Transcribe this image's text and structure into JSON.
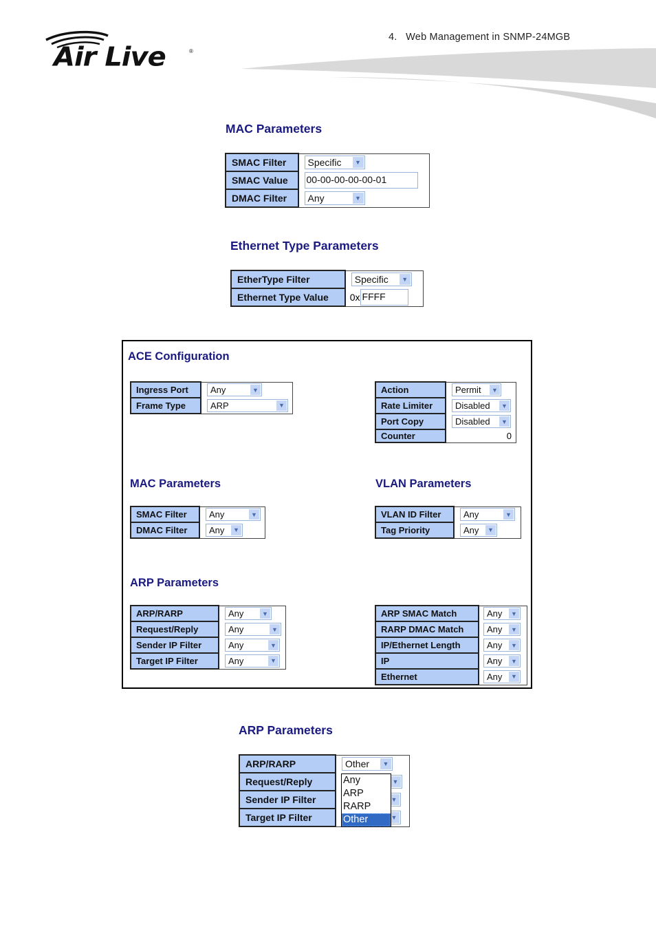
{
  "header": {
    "chapter": "4.   Web Management in SNMP-24MGB",
    "logo": {
      "text": "Air Live",
      "registered": "®"
    }
  },
  "mac_params_top": {
    "title": "MAC Parameters",
    "rows": [
      {
        "label": "SMAC Filter",
        "type": "select",
        "value": "Specific"
      },
      {
        "label": "SMAC Value",
        "type": "input",
        "value": "00-00-00-00-00-01"
      },
      {
        "label": "DMAC Filter",
        "type": "select",
        "value": "Any"
      }
    ]
  },
  "ethertype_params": {
    "title": "Ethernet Type Parameters",
    "rows": [
      {
        "label": "EtherType Filter",
        "type": "select",
        "value": "Specific"
      },
      {
        "label": "Ethernet Type Value",
        "type": "input",
        "prefix": "0x",
        "value": "FFFF"
      }
    ]
  },
  "ace": {
    "title": "ACE Configuration",
    "general": [
      {
        "label": "Ingress Port",
        "value": "Any"
      },
      {
        "label": "Frame Type",
        "value": "ARP"
      }
    ],
    "action": [
      {
        "label": "Action",
        "value": "Permit"
      },
      {
        "label": "Rate Limiter",
        "value": "Disabled"
      },
      {
        "label": "Port Copy",
        "value": "Disabled"
      },
      {
        "label": "Counter",
        "value": "0"
      }
    ],
    "mac": {
      "title": "MAC Parameters",
      "rows": [
        {
          "label": "SMAC Filter",
          "value": "Any"
        },
        {
          "label": "DMAC Filter",
          "value": "Any"
        }
      ]
    },
    "vlan": {
      "title": "VLAN Parameters",
      "rows": [
        {
          "label": "VLAN ID Filter",
          "value": "Any"
        },
        {
          "label": "Tag Priority",
          "value": "Any"
        }
      ]
    },
    "arp": {
      "title": "ARP Parameters",
      "left": [
        {
          "label": "ARP/RARP",
          "value": "Any"
        },
        {
          "label": "Request/Reply",
          "value": "Any"
        },
        {
          "label": "Sender IP Filter",
          "value": "Any"
        },
        {
          "label": "Target IP Filter",
          "value": "Any"
        }
      ],
      "right": [
        {
          "label": "ARP SMAC Match",
          "value": "Any"
        },
        {
          "label": "RARP DMAC Match",
          "value": "Any"
        },
        {
          "label": "IP/Ethernet Length",
          "value": "Any"
        },
        {
          "label": "IP",
          "value": "Any"
        },
        {
          "label": "Ethernet",
          "value": "Any"
        }
      ]
    }
  },
  "arp_params_bottom": {
    "title": "ARP Parameters",
    "rows": [
      {
        "label": "ARP/RARP",
        "value": "Other"
      },
      {
        "label": "Request/Reply",
        "value": ""
      },
      {
        "label": "Sender IP Filter",
        "value": ""
      },
      {
        "label": "Target IP Filter",
        "value": ""
      }
    ],
    "dropdown_options": [
      "Any",
      "ARP",
      "RARP",
      "Other"
    ],
    "dropdown_selected": "Other"
  },
  "colors": {
    "label_bg": "#b4cdf7",
    "title_color": "#1a1a80",
    "highlight": "#316ac5"
  }
}
